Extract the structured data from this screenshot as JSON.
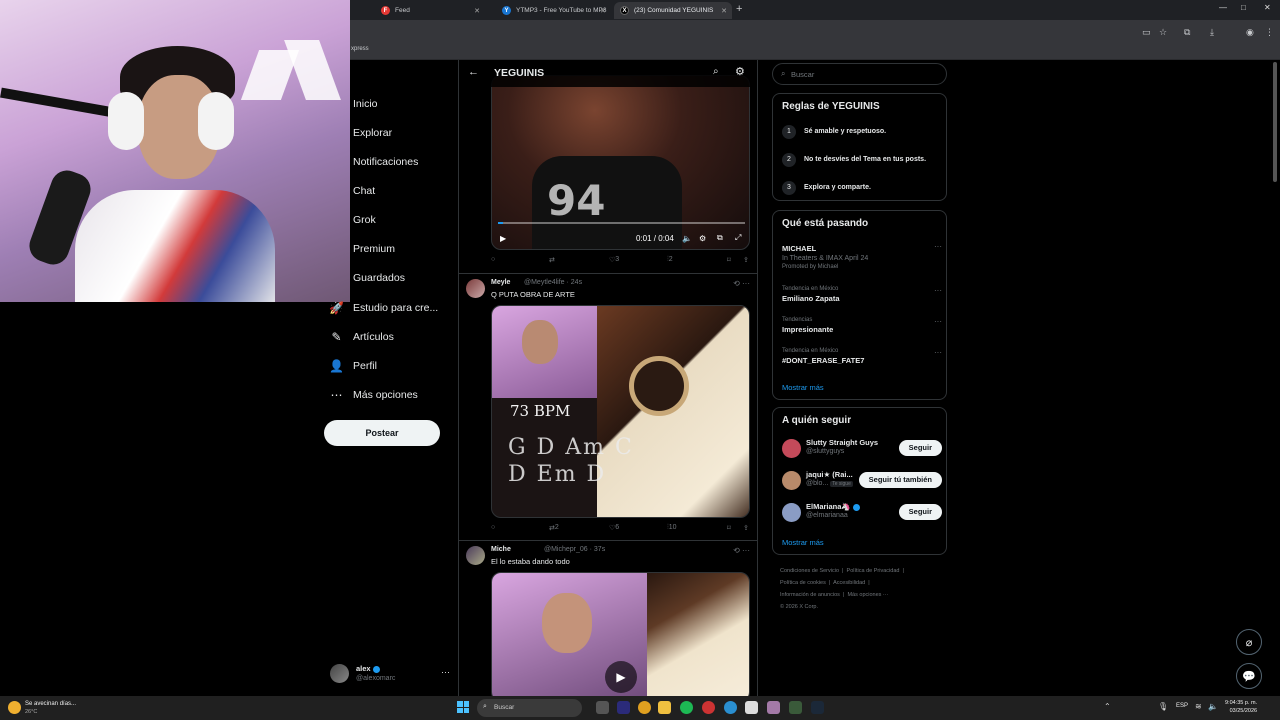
{
  "browser": {
    "tabs": [
      {
        "label": "Feed",
        "favicon": "F",
        "color": "#e53935"
      },
      {
        "label": "YTMP3 - Free YouTube to MP3",
        "favicon": "Y",
        "color": "#1976d2"
      },
      {
        "label": "(23) Comunidad YEGUINIS",
        "favicon": "X",
        "color": "#000000"
      }
    ],
    "new_tab": "+",
    "bookmark_text": "xpress",
    "window": {
      "minimize": "—",
      "maximize": "□",
      "close": "✕"
    }
  },
  "nav": {
    "items": [
      {
        "label": "Inicio",
        "icon": "home-icon",
        "glyph": ""
      },
      {
        "label": "Explorar",
        "icon": "search-icon",
        "glyph": ""
      },
      {
        "label": "Notificaciones",
        "icon": "bell-icon",
        "glyph": ""
      },
      {
        "label": "Chat",
        "icon": "chat-icon",
        "glyph": ""
      },
      {
        "label": "Grok",
        "icon": "grok-icon",
        "glyph": ""
      },
      {
        "label": "Premium",
        "icon": "x-icon",
        "glyph": ""
      },
      {
        "label": "Guardados",
        "icon": "bookmark-icon",
        "glyph": ""
      },
      {
        "label": "Estudio para cre...",
        "icon": "rocket-icon",
        "glyph": "🚀"
      },
      {
        "label": "Artículos",
        "icon": "article-icon",
        "glyph": "✎"
      },
      {
        "label": "Perfil",
        "icon": "person-icon",
        "glyph": "👤"
      },
      {
        "label": "Más opciones",
        "icon": "more-circle-icon",
        "glyph": "⋯"
      }
    ],
    "post_label": "Postear",
    "account": {
      "name": "alex",
      "handle": "@alexomarc",
      "more": "···"
    }
  },
  "header": {
    "title": "YEGUINIS",
    "back": "←",
    "search": "⌕",
    "settings": "⚙"
  },
  "tweets": {
    "first": {
      "time_label": "0:01 / 0:04",
      "progress": 0.02,
      "actions": {
        "reply": "",
        "retweet": "",
        "likes": "3",
        "views": "2"
      }
    },
    "second": {
      "name": "Meyle",
      "meta": "@Meytle4life · 24s",
      "text": "Q PUTA OBRA DE ARTE",
      "bpm": "73 BPM",
      "chords": "G D Am C\nD Em D",
      "actions": {
        "reply": "",
        "retweets": "2",
        "likes": "6",
        "views": "10"
      }
    },
    "third": {
      "name": "Miche",
      "meta": "@Michepr_06 · 37s",
      "text": "El lo estaba dando todo"
    }
  },
  "right": {
    "search_placeholder": "Buscar",
    "rules": {
      "title": "Reglas de YEGUINIS",
      "items": [
        {
          "n": "1",
          "text": "Sé amable y respetuoso."
        },
        {
          "n": "2",
          "text": "No te desvíes del Tema en tus posts."
        },
        {
          "n": "3",
          "text": "Explora y comparte."
        }
      ]
    },
    "trends": {
      "title": "Qué está pasando",
      "items": [
        {
          "context": "",
          "title": "MICHAEL",
          "sub": "In Theaters & IMAX April 24",
          "promo": "Promoted by Michael"
        },
        {
          "context": "Tendencia en México",
          "title": "Emiliano Zapata",
          "sub": "",
          "promo": ""
        },
        {
          "context": "Tendencias",
          "title": "Impresionante",
          "sub": "",
          "promo": ""
        },
        {
          "context": "Tendencia en México",
          "title": "#DONT_ERASE_FATE7",
          "sub": "",
          "promo": ""
        }
      ],
      "show_more": "Mostrar más"
    },
    "follow": {
      "title": "A quién seguir",
      "items": [
        {
          "name": "Slutty Straight Guys",
          "handle": "@sluttyguys",
          "button": "Seguir",
          "color": "#c44a5a"
        },
        {
          "name": "jaqui★ (Rai...",
          "handle": "@blo...",
          "badge": "Te sigue",
          "button": "Seguir tú también",
          "color": "#b88a6a"
        },
        {
          "name": "ElMariana🦄",
          "handle": "@elmarianaa",
          "button": "Seguir",
          "color": "#8a9cc4"
        }
      ],
      "show_more": "Mostrar más"
    },
    "footer": "Condiciones de Servicio  |  Política de Privacidad  |\nPolítica de cookies  |  Accesibilidad  |\nInformación de anuncios  |  Más opciones ···\n© 2026 X Corp."
  },
  "taskbar": {
    "weather_title": "Se avecinan días...",
    "weather_temp": "26°C",
    "search_placeholder": "Buscar",
    "lang": "ESP",
    "time": "9:04:35 p. m.",
    "date": "03/25/2026"
  }
}
